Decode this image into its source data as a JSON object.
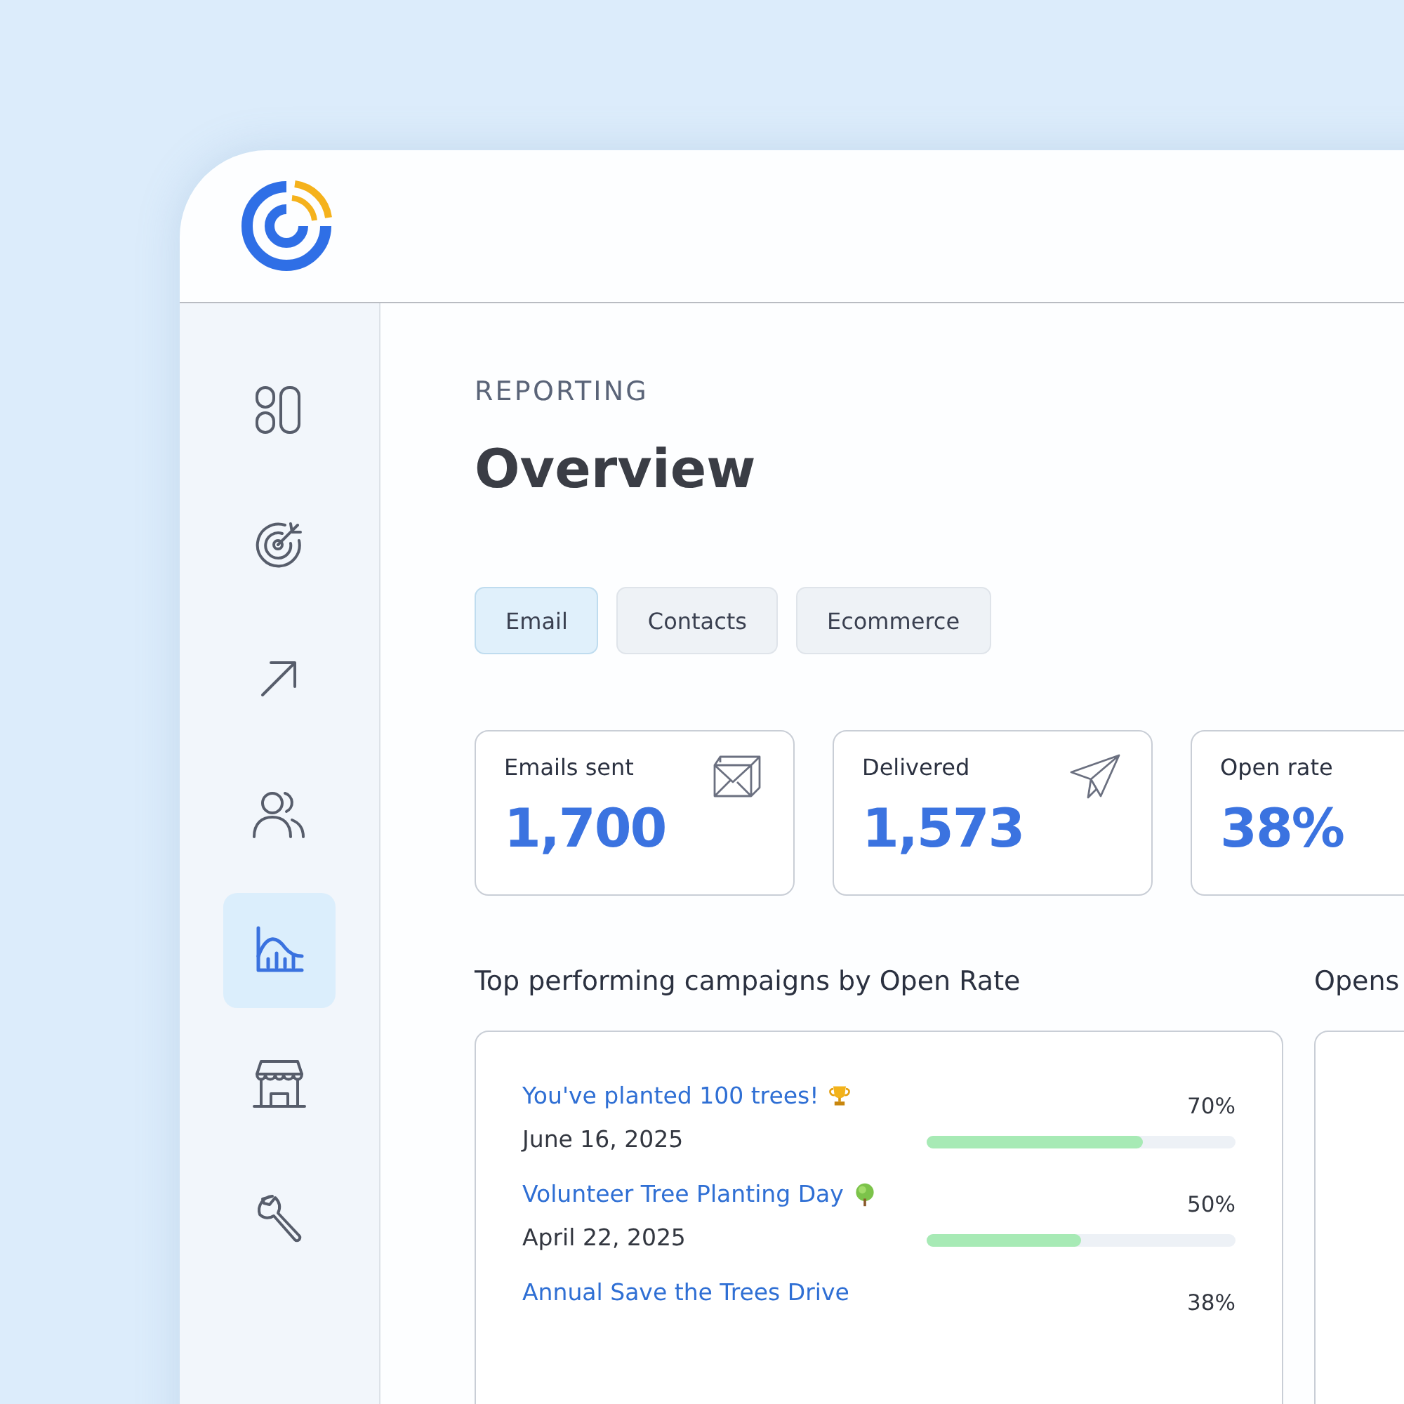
{
  "sidebar": {
    "items": [
      {
        "kind": "tiles",
        "selected": false
      },
      {
        "kind": "target",
        "selected": false
      },
      {
        "kind": "arrow",
        "selected": false
      },
      {
        "kind": "people",
        "selected": false
      },
      {
        "kind": "chart",
        "selected": true
      },
      {
        "kind": "shop",
        "selected": false
      },
      {
        "kind": "wrench",
        "selected": false
      }
    ]
  },
  "page": {
    "eyebrow": "REPORTING",
    "title": "Overview"
  },
  "tabs": [
    {
      "label": "Email",
      "selected": true
    },
    {
      "label": "Contacts",
      "selected": false
    },
    {
      "label": "Ecommerce",
      "selected": false
    }
  ],
  "stats": [
    {
      "label": "Emails sent",
      "value": "1,700",
      "kind": "envelope"
    },
    {
      "label": "Delivered",
      "value": "1,573",
      "kind": "plane"
    },
    {
      "label": "Open rate",
      "value": "38%",
      "kind": "plain"
    }
  ],
  "campaigns": {
    "title": "Top performing campaigns by Open Rate",
    "rows": [
      {
        "name": "You've planted 100 trees!",
        "kind": "trophy",
        "date": "June 16, 2025",
        "percent": "70%",
        "level": 0.7
      },
      {
        "name": "Volunteer Tree Planting Day",
        "kind": "tree",
        "date": "April 22, 2025",
        "percent": "50%",
        "level": 0.5
      },
      {
        "name": "Annual Save the Trees Drive",
        "kind": "plain",
        "percent": "38%"
      }
    ]
  },
  "opens_panel": {
    "title": "Opens"
  }
}
